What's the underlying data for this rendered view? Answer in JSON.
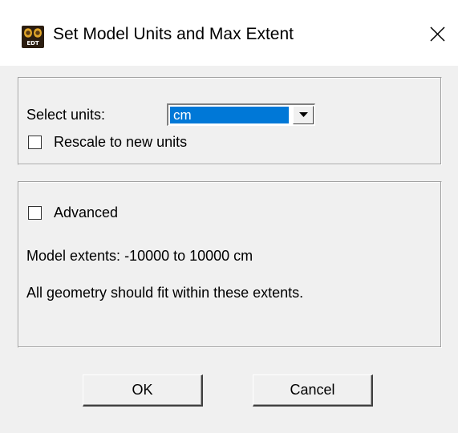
{
  "window": {
    "title": "Set Model Units and Max Extent",
    "logo_text": "EDT",
    "close_glyph": "✕"
  },
  "units": {
    "label": "Select units:",
    "selected": "cm",
    "rescale_label": "Rescale to new units",
    "rescale_checked": false
  },
  "advanced": {
    "label": "Advanced",
    "checked": false,
    "extents_text": "Model extents: -10000 to 10000 cm",
    "note_text": "All geometry should fit within these extents."
  },
  "buttons": {
    "ok": "OK",
    "cancel": "Cancel"
  },
  "colors": {
    "selection": "#0078d7",
    "dialog_bg": "#f0f0f0"
  }
}
